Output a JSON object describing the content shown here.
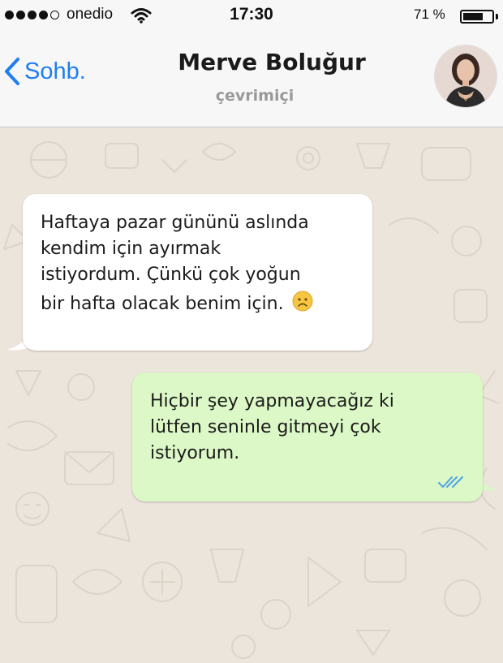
{
  "status_bar": {
    "carrier": "onedio",
    "time": "17:30",
    "battery_percent": "71 %",
    "battery_level": 0.71,
    "signal_bars_filled": 4,
    "signal_bars_total": 5
  },
  "header": {
    "back_label": "Sohb.",
    "contact_name": "Merve Boluğur",
    "contact_status": "çevrimiçi"
  },
  "messages": [
    {
      "direction": "incoming",
      "text": "Haftaya pazar gününü aslında\nkendim için ayırmak\nistiyordum. Çünkü çok yoğun\nbir hafta olacak benim için.",
      "emoji": "🙁"
    },
    {
      "direction": "outgoing",
      "text": "Hiçbir şey yapmayacağız ki\nlütfen seninle gitmeyi çok\nistiyorum.",
      "status": "read"
    }
  ],
  "colors": {
    "accent": "#1f7ef1",
    "chat_background": "#ece5dc",
    "incoming_bubble": "#ffffff",
    "outgoing_bubble": "#dcf8c6",
    "read_ticks": "#4fa3e0"
  }
}
